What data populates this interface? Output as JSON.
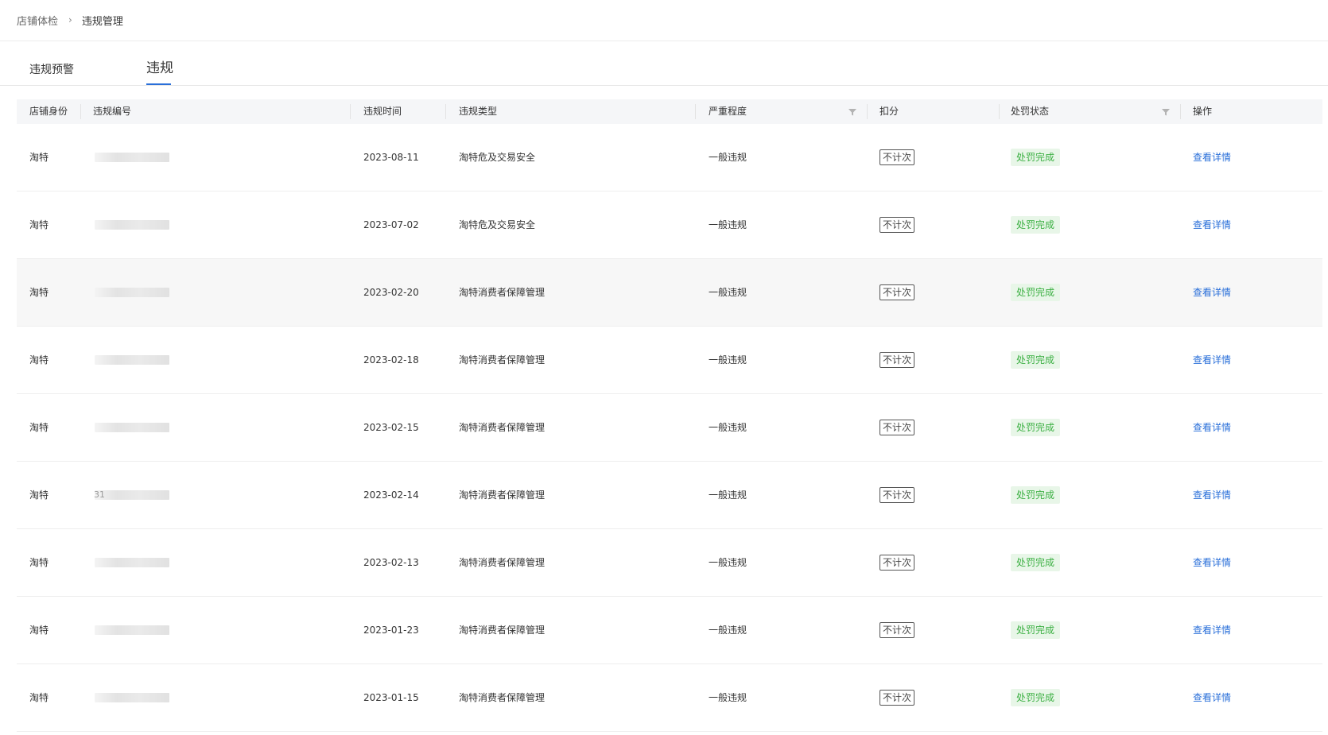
{
  "breadcrumb": {
    "parent": "店铺体检",
    "separator": "›",
    "current": "违规管理"
  },
  "tabs": [
    {
      "label": "违规预警",
      "active": false
    },
    {
      "label": "违规",
      "active": true
    }
  ],
  "colors": {
    "accent": "#2a6fd9",
    "status_bg": "#e8f6e8",
    "status_text": "#3cb043",
    "header_bg": "#f5f6f8"
  },
  "table": {
    "headers": {
      "identity": "店铺身份",
      "number": "违规编号",
      "time": "违规时间",
      "type": "违规类型",
      "severity": "严重程度",
      "score": "扣分",
      "status": "处罚状态",
      "action": "操作"
    },
    "filter_icon": "funnel-icon",
    "rows": [
      {
        "identity": "淘特",
        "number_visible": "",
        "time": "2023-08-11",
        "type": "淘特危及交易安全",
        "severity": "一般违规",
        "score": "不计次",
        "status": "处罚完成",
        "action": "查看详情"
      },
      {
        "identity": "淘特",
        "number_visible": "",
        "time": "2023-07-02",
        "type": "淘特危及交易安全",
        "severity": "一般违规",
        "score": "不计次",
        "status": "处罚完成",
        "action": "查看详情"
      },
      {
        "identity": "淘特",
        "number_visible": "",
        "time": "2023-02-20",
        "type": "淘特消费者保障管理",
        "severity": "一般违规",
        "score": "不计次",
        "status": "处罚完成",
        "action": "查看详情"
      },
      {
        "identity": "淘特",
        "number_visible": "",
        "time": "2023-02-18",
        "type": "淘特消费者保障管理",
        "severity": "一般违规",
        "score": "不计次",
        "status": "处罚完成",
        "action": "查看详情"
      },
      {
        "identity": "淘特",
        "number_visible": "",
        "time": "2023-02-15",
        "type": "淘特消费者保障管理",
        "severity": "一般违规",
        "score": "不计次",
        "status": "处罚完成",
        "action": "查看详情"
      },
      {
        "identity": "淘特",
        "number_visible": "31",
        "time": "2023-02-14",
        "type": "淘特消费者保障管理",
        "severity": "一般违规",
        "score": "不计次",
        "status": "处罚完成",
        "action": "查看详情"
      },
      {
        "identity": "淘特",
        "number_visible": "",
        "time": "2023-02-13",
        "type": "淘特消费者保障管理",
        "severity": "一般违规",
        "score": "不计次",
        "status": "处罚完成",
        "action": "查看详情"
      },
      {
        "identity": "淘特",
        "number_visible": "",
        "time": "2023-01-23",
        "type": "淘特消费者保障管理",
        "severity": "一般违规",
        "score": "不计次",
        "status": "处罚完成",
        "action": "查看详情"
      },
      {
        "identity": "淘特",
        "number_visible": "",
        "time": "2023-01-15",
        "type": "淘特消费者保障管理",
        "severity": "一般违规",
        "score": "不计次",
        "status": "处罚完成",
        "action": "查看详情"
      }
    ]
  }
}
